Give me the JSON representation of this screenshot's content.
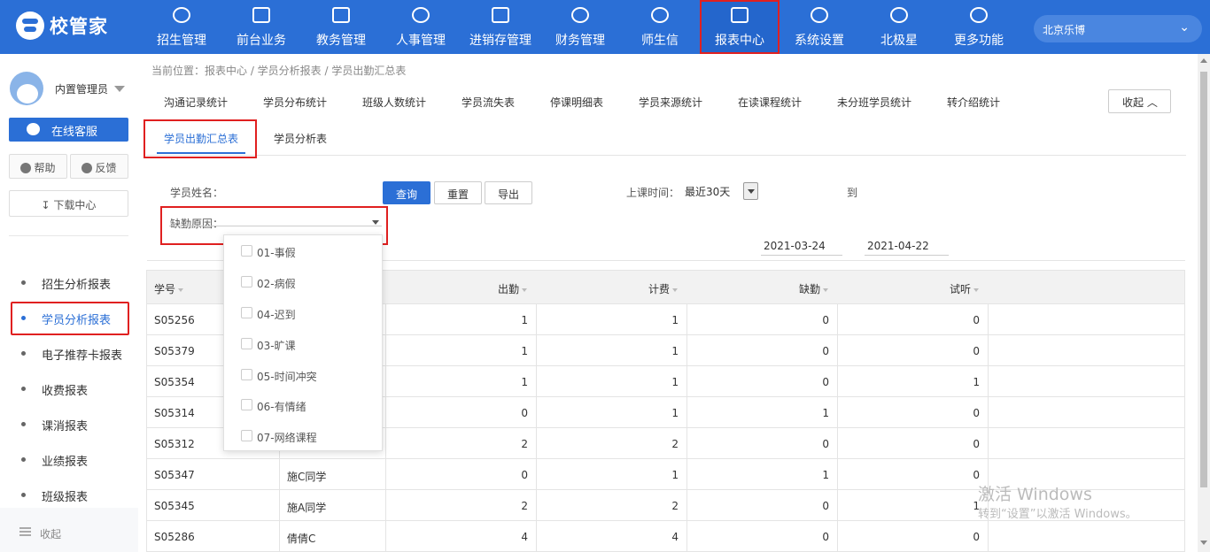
{
  "app": {
    "logo": "校管家",
    "city": "北京乐博",
    "accent": "#2b6fd6",
    "highlight": "#e02020"
  },
  "nav": [
    {
      "label": "招生管理",
      "icon": "user-plus-icon"
    },
    {
      "label": "前台业务",
      "icon": "monitor-icon"
    },
    {
      "label": "教务管理",
      "icon": "book-icon"
    },
    {
      "label": "人事管理",
      "icon": "person-icon"
    },
    {
      "label": "进销存管理",
      "icon": "inbox-icon"
    },
    {
      "label": "财务管理",
      "icon": "yen-shield-icon"
    },
    {
      "label": "师生信",
      "icon": "chat-icon"
    },
    {
      "label": "报表中心",
      "icon": "bar-chart-icon",
      "active": true
    },
    {
      "label": "系统设置",
      "icon": "gear-icon"
    },
    {
      "label": "北极星",
      "icon": "star-icon"
    },
    {
      "label": "更多功能",
      "icon": "more-icon"
    }
  ],
  "user": {
    "name": "内置管理员"
  },
  "sidebar": {
    "service": "在线客服",
    "help": "帮助",
    "feedback": "反馈",
    "download": "下载中心",
    "items": [
      "招生分析报表",
      "学员分析报表",
      "电子推荐卡报表",
      "收费报表",
      "课消报表",
      "业绩报表",
      "班级报表"
    ],
    "collapse": "收起"
  },
  "breadcrumb": "当前位置：报表中心 / 学员分析报表 / 学员出勤汇总表",
  "tabs1": [
    "沟通记录统计",
    "学员分布统计",
    "班级人数统计",
    "学员流失表",
    "停课明细表",
    "学员来源统计",
    "在读课程统计",
    "未分班学员统计",
    "转介绍统计"
  ],
  "collapse_btn": "收起 ︿",
  "tabs2": [
    "学员出勤汇总表",
    "学员分析表"
  ],
  "filters": {
    "student_name_label": "学员姓名：",
    "query": "查询",
    "reset": "重置",
    "export": "导出",
    "class_time_label": "上课时间：",
    "range": "最近30天",
    "date_from": "2021-03-24",
    "to": "到",
    "date_to": "2021-04-22",
    "absence_label": "缺勤原因："
  },
  "absence_options": [
    "01-事假",
    "02-病假",
    "04-迟到",
    "03-旷课",
    "05-时间冲突",
    "06-有情绪",
    "07-网络课程"
  ],
  "table": {
    "headers": [
      "学号",
      "出勤",
      "计费",
      "缺勤",
      "试听"
    ],
    "rows": [
      {
        "id": "S05256",
        "name": "",
        "att": "1",
        "bill": "1",
        "abs": "0",
        "trial": "0"
      },
      {
        "id": "S05379",
        "name": "",
        "att": "1",
        "bill": "1",
        "abs": "0",
        "trial": "0"
      },
      {
        "id": "S05354",
        "name": "",
        "att": "1",
        "bill": "1",
        "abs": "0",
        "trial": "1"
      },
      {
        "id": "S05314",
        "name": "",
        "att": "0",
        "bill": "1",
        "abs": "1",
        "trial": "0"
      },
      {
        "id": "S05312",
        "name": "",
        "att": "2",
        "bill": "2",
        "abs": "0",
        "trial": "0"
      },
      {
        "id": "S05347",
        "name": "施C同学",
        "att": "0",
        "bill": "1",
        "abs": "1",
        "trial": "0"
      },
      {
        "id": "S05345",
        "name": "施A同学",
        "att": "2",
        "bill": "2",
        "abs": "0",
        "trial": "1"
      },
      {
        "id": "S05286",
        "name": "倩倩C",
        "att": "4",
        "bill": "4",
        "abs": "0",
        "trial": "0"
      }
    ]
  },
  "watermark": {
    "line1": "激活 Windows",
    "line2": "转到“设置”以激活 Windows。"
  }
}
